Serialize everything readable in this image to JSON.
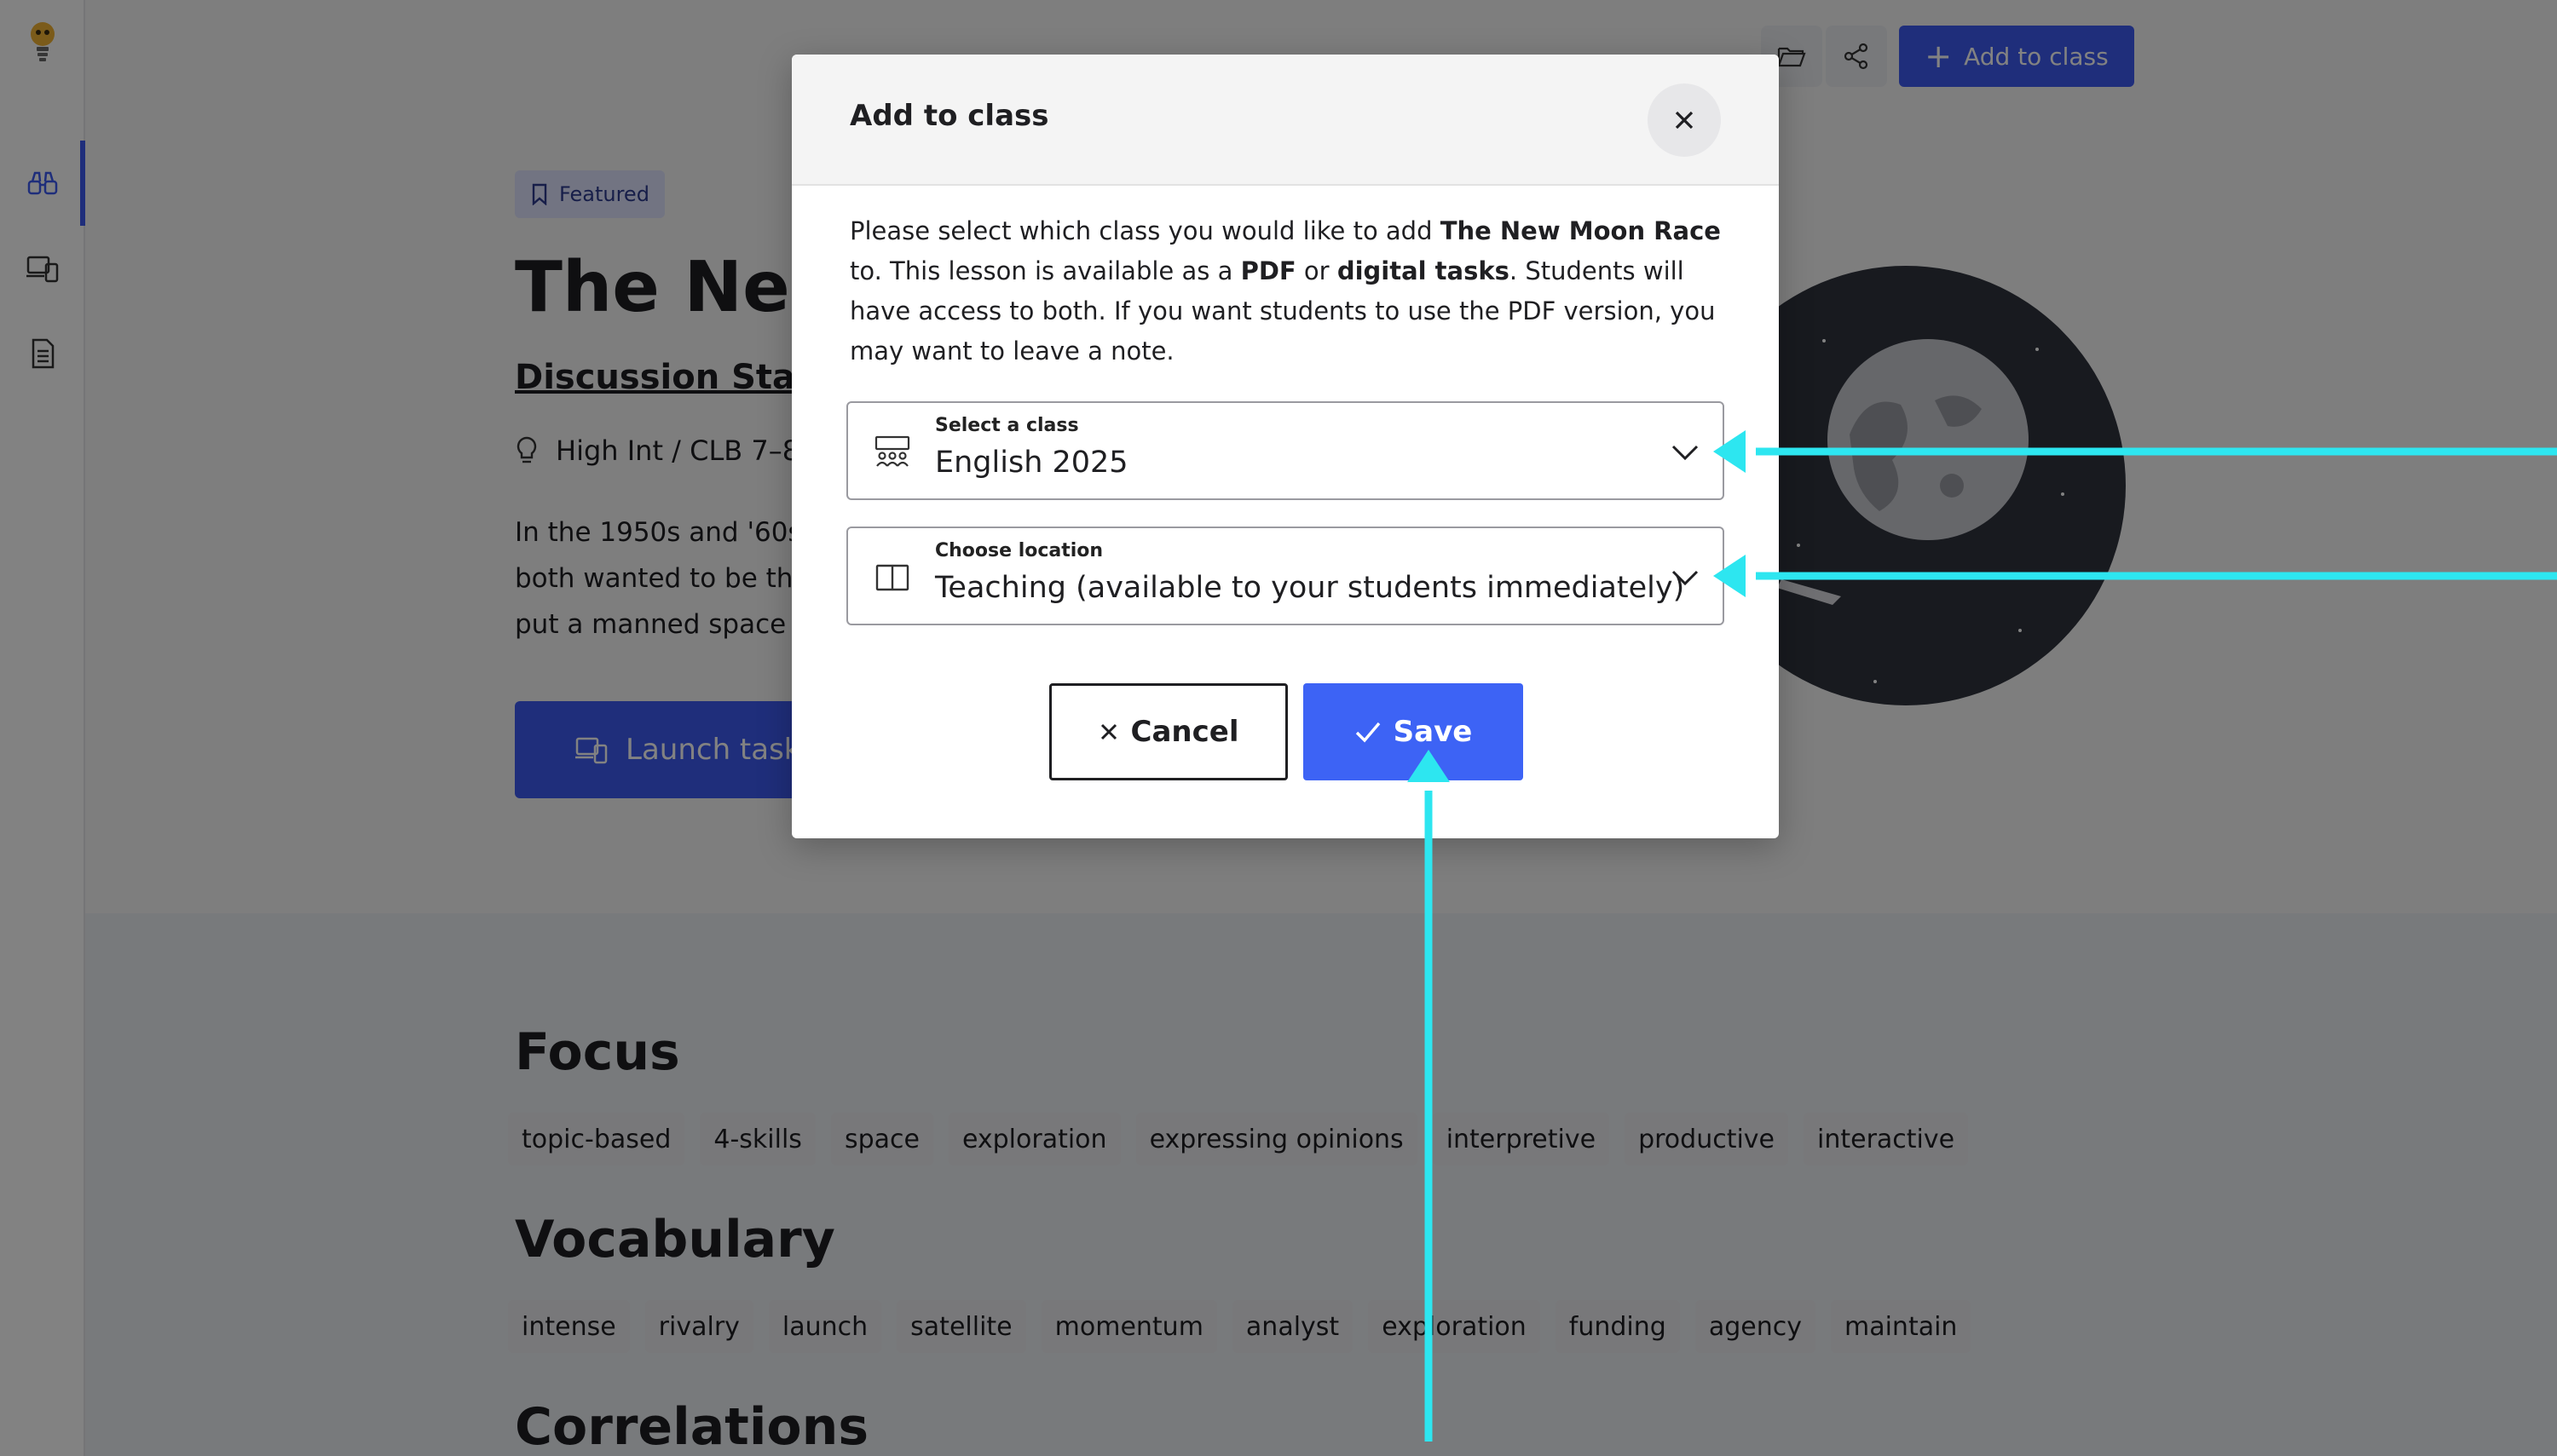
{
  "header": {
    "add_to_class_label": "Add to class"
  },
  "lesson": {
    "badge": "Featured",
    "title": "The New",
    "subtitle": "Discussion Start",
    "level": "High Int / CLB 7–8",
    "description_lines": [
      "In the 1950s and '60s",
      "both wanted to be th",
      "put a manned space"
    ],
    "launch_label": "Launch task"
  },
  "sections": {
    "focus": {
      "title": "Focus",
      "tags": [
        "topic-based",
        "4-skills",
        "space",
        "exploration",
        "expressing opinions",
        "interpretive",
        "productive",
        "interactive"
      ]
    },
    "vocabulary": {
      "title": "Vocabulary",
      "tags": [
        "intense",
        "rivalry",
        "launch",
        "satellite",
        "momentum",
        "analyst",
        "exploration",
        "funding",
        "agency",
        "maintain"
      ]
    },
    "correlations": {
      "title": "Correlations"
    }
  },
  "modal": {
    "title": "Add to class",
    "body": {
      "p1": "Please select which class you would like to add ",
      "lesson_name": "The New Moon Race",
      "p2": " to. This lesson is available as a ",
      "pdf": "PDF",
      "p3": " or ",
      "digital": "digital tasks",
      "p4": ". Students will have access to both. If you want students to use the PDF version, you may want to leave a note."
    },
    "class_select": {
      "label": "Select a class",
      "value": "English 2025"
    },
    "location_select": {
      "label": "Choose location",
      "value": "Teaching (available to your students immediately)"
    },
    "cancel_label": "Cancel",
    "save_label": "Save"
  },
  "colors": {
    "accent": "#3d5af1",
    "save": "#3d63f5",
    "annotation": "#2de6f0"
  },
  "icons": {
    "logo": "lightbulb-logo-icon",
    "sidebar": [
      "binoculars-icon",
      "devices-icon",
      "document-icon"
    ],
    "folder": "folder-open-icon",
    "share": "share-icon"
  }
}
